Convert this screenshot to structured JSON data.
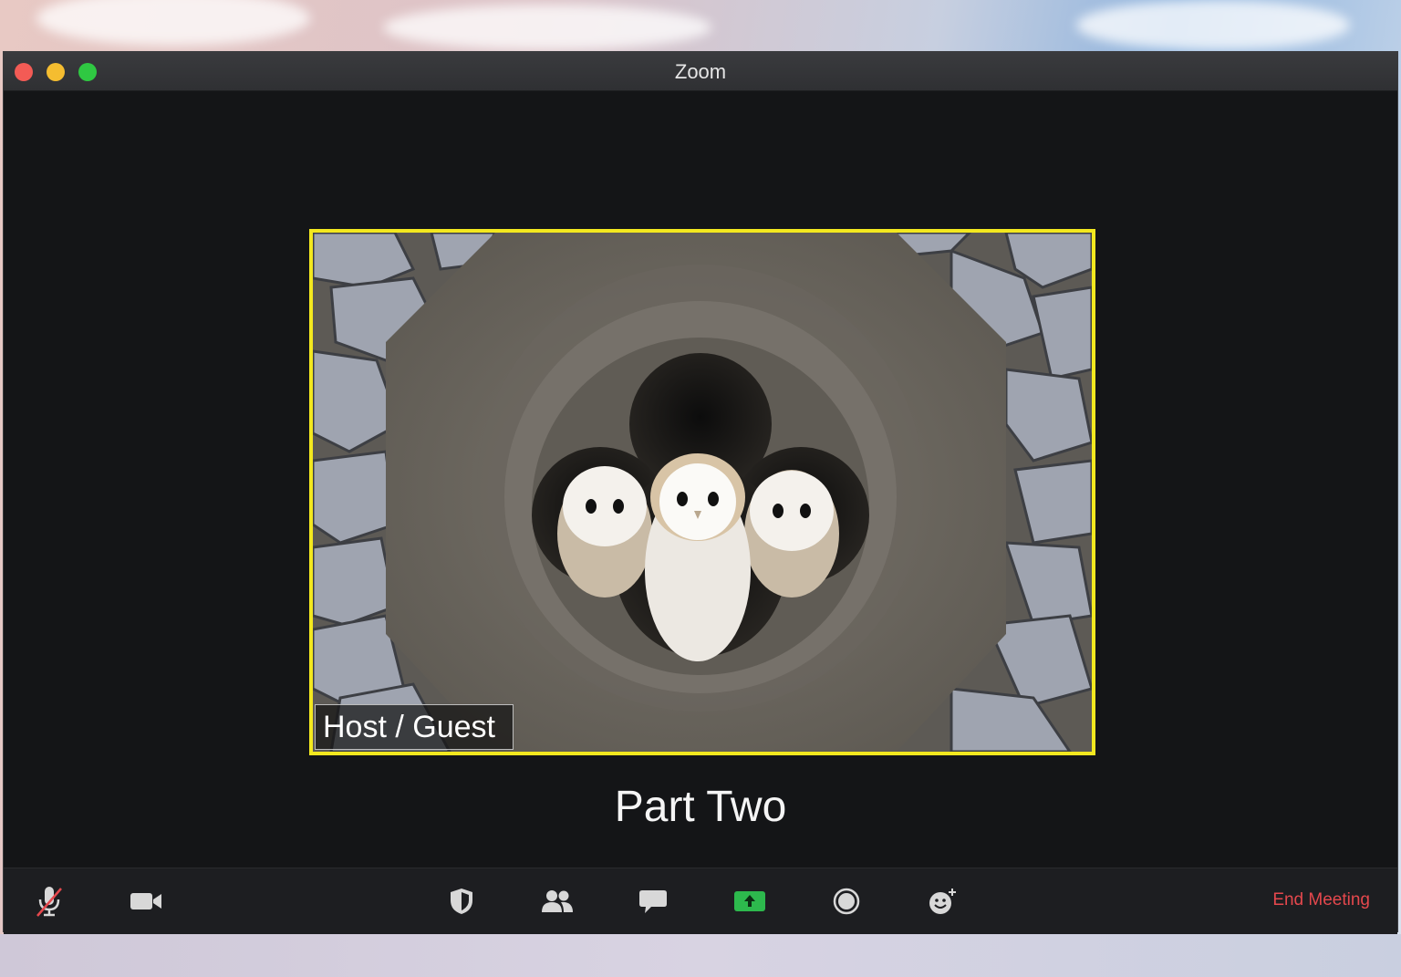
{
  "window": {
    "title": "Zoom"
  },
  "video": {
    "participant_name": "Host / Guest",
    "highlight_color": "#f3e81f"
  },
  "caption": "Part Two",
  "toolbar": {
    "items": [
      {
        "icon": "microphone-muted-icon"
      },
      {
        "icon": "video-camera-icon"
      },
      {
        "icon": "security-shield-icon"
      },
      {
        "icon": "participants-icon"
      },
      {
        "icon": "chat-icon"
      },
      {
        "icon": "share-screen-icon",
        "accent": "#2db94d"
      },
      {
        "icon": "record-icon"
      },
      {
        "icon": "reactions-icon"
      }
    ],
    "end_label": "End Meeting",
    "end_color": "#e5484d"
  }
}
